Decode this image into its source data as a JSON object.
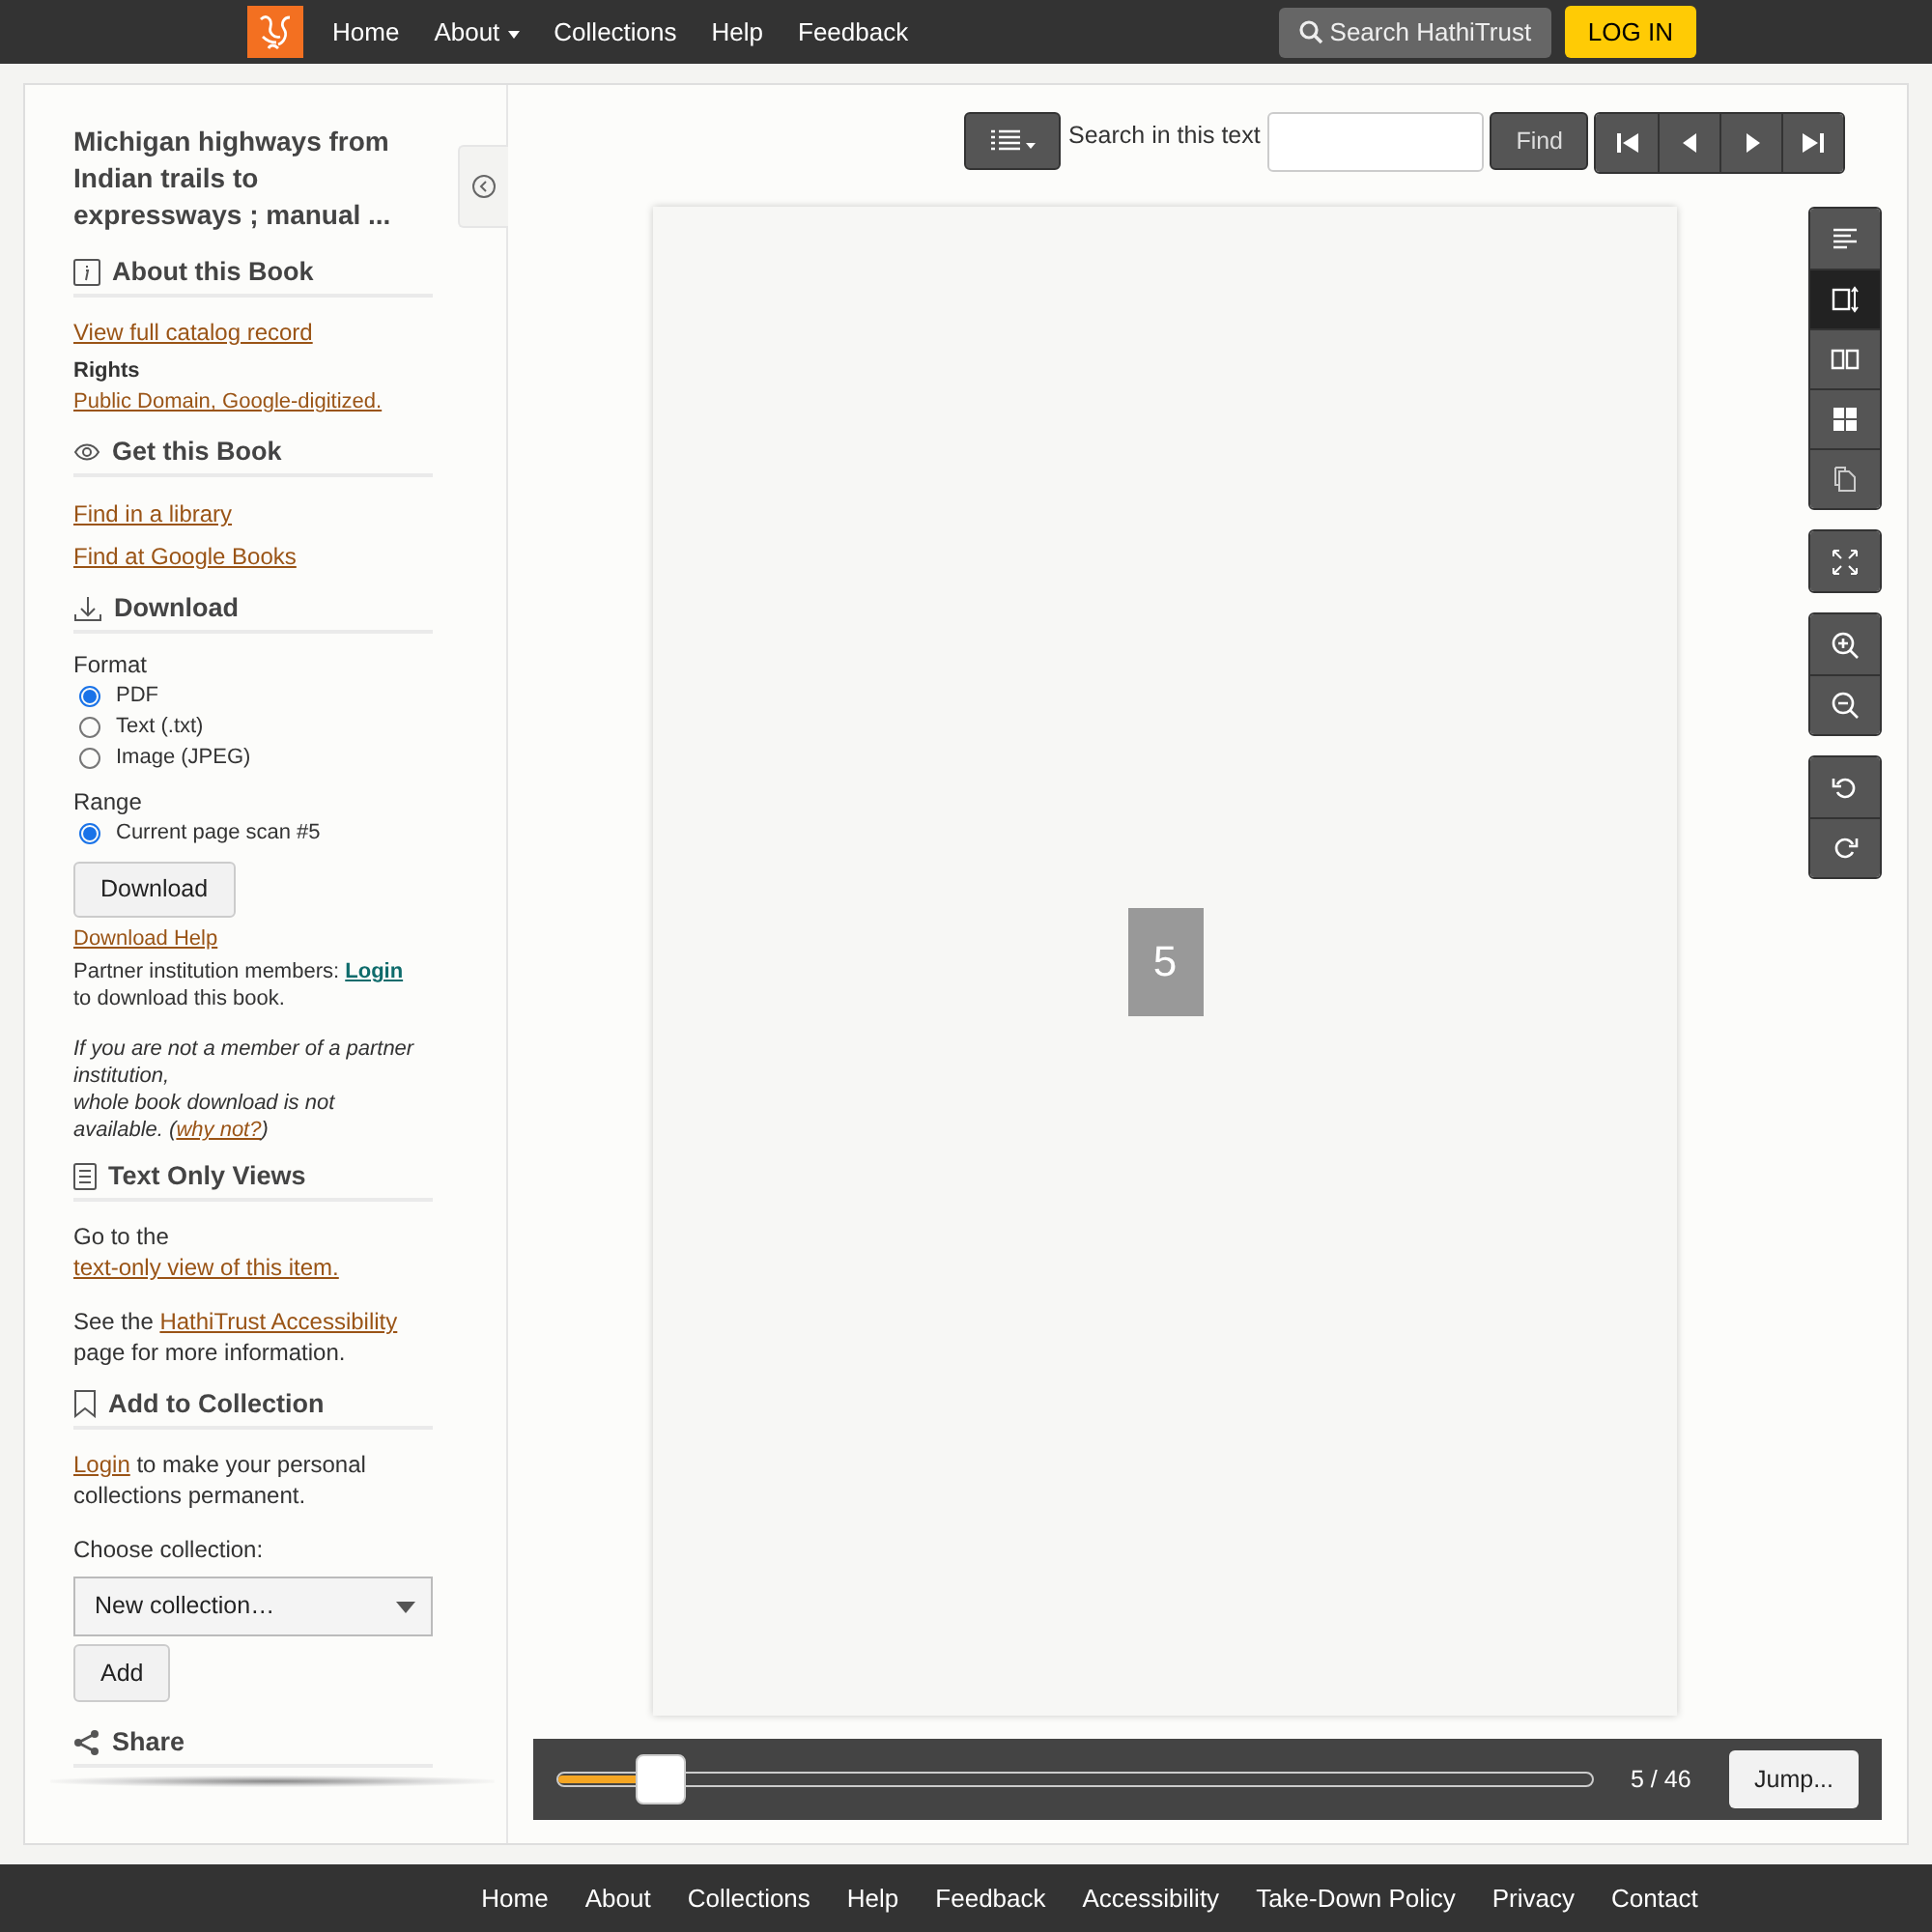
{
  "nav": {
    "items": [
      {
        "label": "Home",
        "dropdown": false
      },
      {
        "label": "About",
        "dropdown": true
      },
      {
        "label": "Collections",
        "dropdown": false
      },
      {
        "label": "Help",
        "dropdown": false
      },
      {
        "label": "Feedback",
        "dropdown": false
      }
    ],
    "search": "Search HathiTrust",
    "login": "LOG IN"
  },
  "sidebar": {
    "title": "Michigan highways from Indian trails to expressways ; manual ...",
    "about": {
      "heading": "About this Book",
      "catalog_link": "View full catalog record",
      "rights_label": "Rights",
      "rights_link": "Public Domain, Google-digitized."
    },
    "get": {
      "heading": "Get this Book",
      "links": [
        "Find in a library",
        "Find at Google Books"
      ]
    },
    "download": {
      "heading": "Download",
      "format_label": "Format",
      "formats": [
        {
          "label": "PDF",
          "selected": true
        },
        {
          "label": "Text (.txt)",
          "selected": false
        },
        {
          "label": "Image (JPEG)",
          "selected": false
        }
      ],
      "range_label": "Range",
      "ranges": [
        {
          "label": "Current page scan #5",
          "selected": true
        }
      ],
      "button": "Download",
      "help_link": "Download Help",
      "partner": {
        "before": "Partner institution members: ",
        "link": "Login",
        "after": " to download this book."
      },
      "notice": {
        "line1": "If you are not a member of a partner institution,",
        "line2": "whole book download is not available. (",
        "link": "why not?",
        "after": ")"
      }
    },
    "text_only": {
      "heading": "Text Only Views",
      "intro": "Go to the",
      "link": "text-only view of this item.",
      "see_before": "See the ",
      "see_link": "HathiTrust Accessibility",
      "see_after": " page for more information."
    },
    "collection": {
      "heading": "Add to Collection",
      "login_link": "Login",
      "login_after": " to make your personal collections permanent.",
      "choose_label": "Choose collection:",
      "select_value": "New collection…",
      "add_button": "Add"
    },
    "share": {
      "heading": "Share"
    }
  },
  "viewer": {
    "search_label": "Search in this text",
    "find_button": "Find",
    "view_modes": [
      {
        "selected": false
      },
      {
        "selected": true
      },
      {
        "selected": false
      },
      {
        "selected": false
      },
      {
        "selected": false
      }
    ],
    "page_number": "5",
    "slider": {
      "level": 0.1,
      "reading": "5 / 46",
      "jump": "Jump..."
    }
  },
  "footer": [
    "Home",
    "About",
    "Collections",
    "Help",
    "Feedback",
    "Accessibility",
    "Take-Down Policy",
    "Privacy",
    "Contact"
  ]
}
